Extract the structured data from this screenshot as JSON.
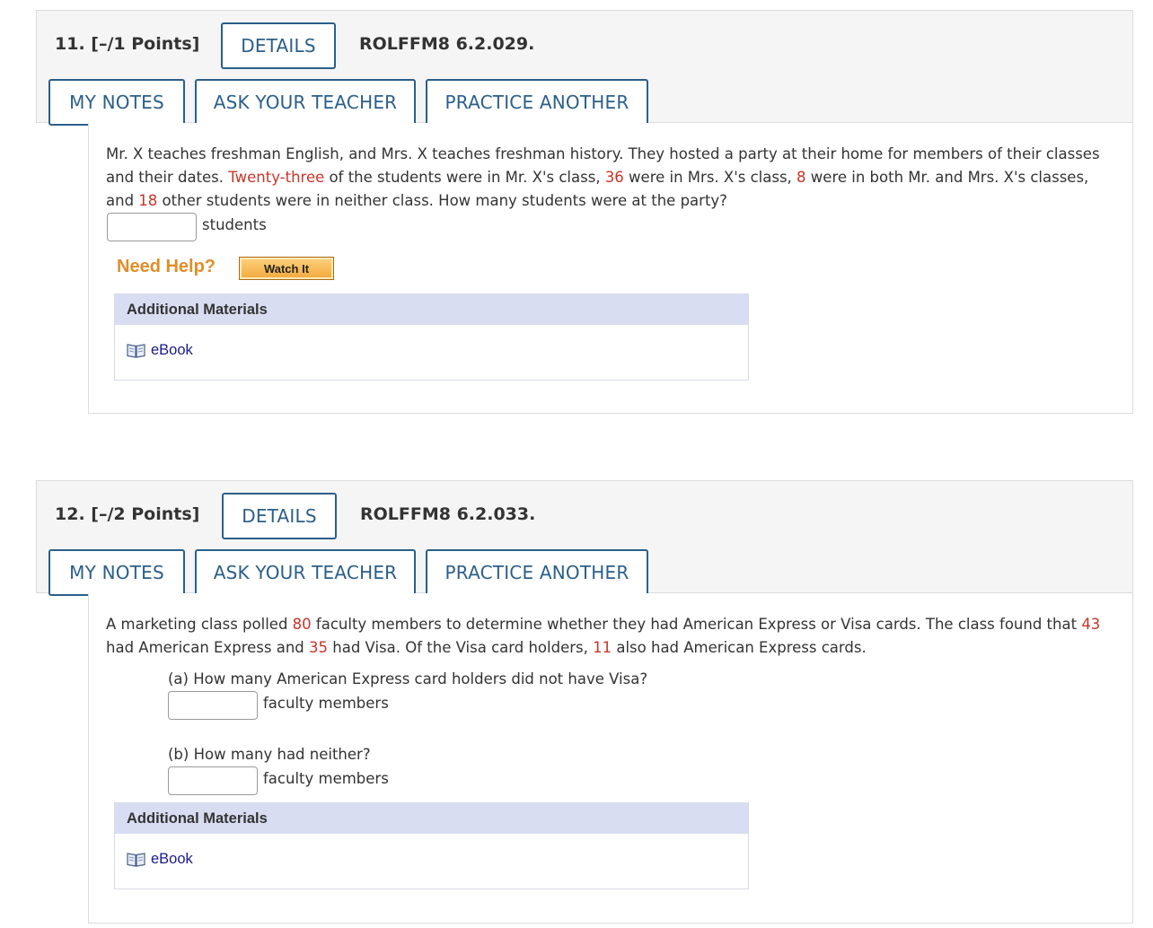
{
  "questions": [
    {
      "number_label": "11.",
      "points_label": "[–/1 Points]",
      "details_label": "DETAILS",
      "code": "ROLFFM8 6.2.029.",
      "my_notes_label": "MY NOTES",
      "ask_teacher_label": "ASK YOUR TEACHER",
      "practice_label": "PRACTICE ANOTHER",
      "text": {
        "p1": "Mr. X teaches freshman English, and Mrs. X teaches freshman history. They hosted a party at their home for members of their classes and their dates. ",
        "v1": "Twenty-three",
        "p2": " of the students were in Mr. X's class, ",
        "v2": "36",
        "p3": " were in Mrs. X's class, ",
        "v3": "8",
        "p4": " were in both Mr. and Mrs. X's classes, and ",
        "v4": "18",
        "p5": " other students were in neither class. How many students were at the party?"
      },
      "answer_unit": "students",
      "need_help_label": "Need Help?",
      "watch_it_label": "Watch It",
      "materials_title": "Additional Materials",
      "ebook_label": "eBook"
    },
    {
      "number_label": "12.",
      "points_label": "[–/2 Points]",
      "details_label": "DETAILS",
      "code": "ROLFFM8 6.2.033.",
      "my_notes_label": "MY NOTES",
      "ask_teacher_label": "ASK YOUR TEACHER",
      "practice_label": "PRACTICE ANOTHER",
      "text": {
        "p1": "A marketing class polled ",
        "v1": "80",
        "p2": " faculty members to determine whether they had American Express or Visa cards. The class found that ",
        "v2": "43",
        "p3": " had American Express and ",
        "v3": "35",
        "p4": " had Visa. Of the Visa card holders, ",
        "v4": "11",
        "p5": " also had American Express cards."
      },
      "part_a": "(a) How many American Express card holders did not have Visa?",
      "part_a_unit": "faculty members",
      "part_b": "(b) How many had neither?",
      "part_b_unit": "faculty members",
      "materials_title": "Additional Materials",
      "ebook_label": "eBook"
    }
  ],
  "colors": {
    "accent_blue": "#2b5f8a",
    "highlight_red": "#c8352a",
    "need_help_orange": "#e08e2b",
    "materials_header": "#d8ddf1",
    "ebook_link": "#1a1a8c"
  },
  "icons": {
    "ebook": "book-icon"
  }
}
